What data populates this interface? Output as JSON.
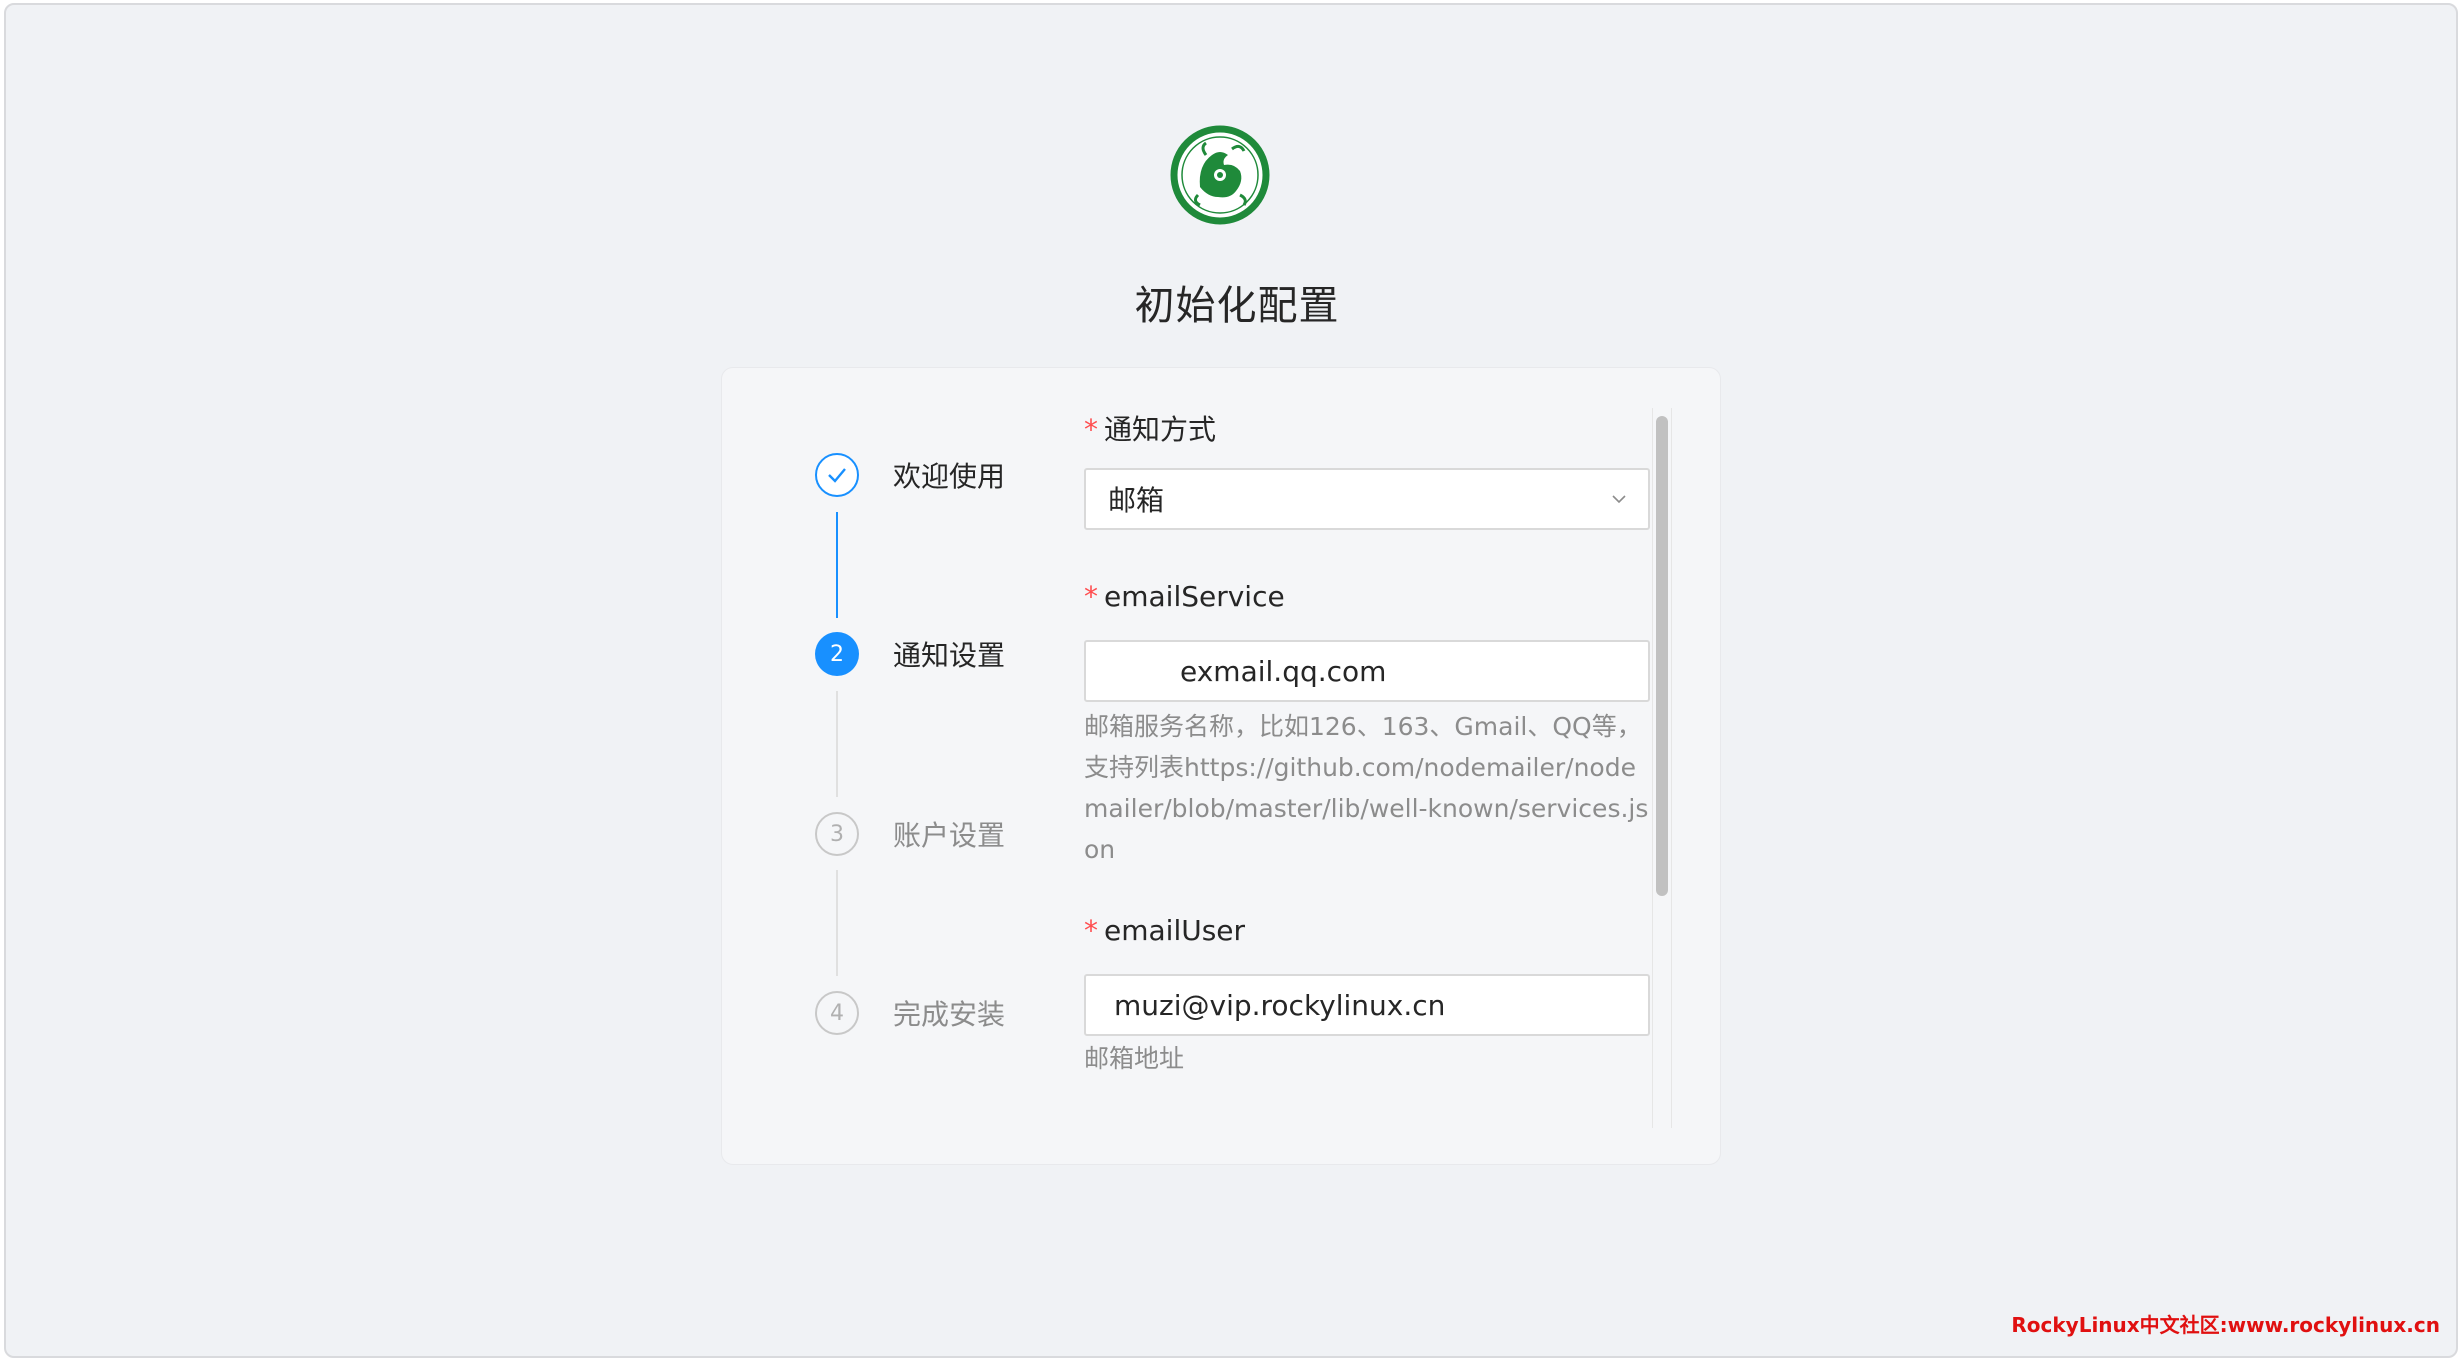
{
  "page": {
    "title": "初始化配置"
  },
  "steps": [
    {
      "number": "1",
      "label": "欢迎使用",
      "status": "finished"
    },
    {
      "number": "2",
      "label": "通知设置",
      "status": "active"
    },
    {
      "number": "3",
      "label": "账户设置",
      "status": "waiting"
    },
    {
      "number": "4",
      "label": "完成安装",
      "status": "waiting"
    }
  ],
  "form": {
    "notify_method": {
      "label": "通知方式",
      "value": "邮箱",
      "required_mark": "*"
    },
    "email_service": {
      "label": "emailService",
      "value": "exmail.qq.com",
      "help": "邮箱服务名称，比如126、163、Gmail、QQ等，支持列表https://github.com/nodemailer/nodemailer/blob/master/lib/well-known/services.json",
      "required_mark": "*"
    },
    "email_user": {
      "label": "emailUser",
      "value": "muzi@vip.rockylinux.cn",
      "help": "邮箱地址",
      "required_mark": "*"
    }
  },
  "watermark": "RockyLinux中文社区:www.rockylinux.cn",
  "colors": {
    "primary": "#1890ff",
    "required": "#ff4d4f",
    "logo_green": "#1f8a3a",
    "watermark": "#e01010"
  }
}
